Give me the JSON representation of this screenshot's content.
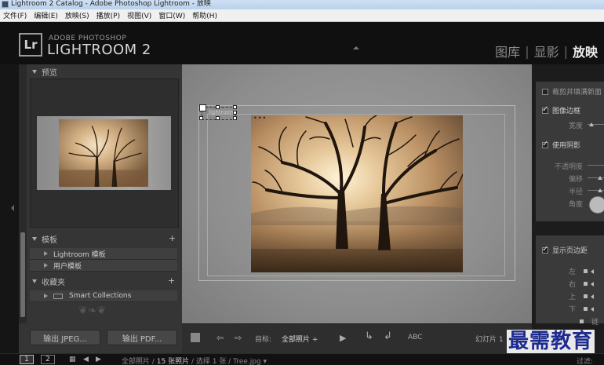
{
  "window": {
    "title": "Lightroom 2 Catalog - Adobe Photoshop Lightroom - 放映"
  },
  "menu": [
    "文件(F)",
    "编辑(E)",
    "放映(S)",
    "播放(P)",
    "视图(V)",
    "窗口(W)",
    "帮助(H)"
  ],
  "brand": {
    "logo": "Lr",
    "line1": "ADOBE PHOTOSHOP",
    "line2": "LIGHTROOM 2"
  },
  "modules": [
    {
      "label": "图库",
      "active": false
    },
    {
      "label": "显影",
      "active": false
    },
    {
      "label": "放映",
      "active": true
    }
  ],
  "left": {
    "preview_title": "预览",
    "templates_title": "模板",
    "templates": [
      "Lightroom 模板",
      "用户模板"
    ],
    "collections_title": "收藏夹",
    "collections": [
      "Smart Collections"
    ],
    "export_jpeg": "输出 JPEG...",
    "export_pdf": "输出 PDF..."
  },
  "slide": {
    "identity_text": "lightroom"
  },
  "toolbar": {
    "target_label": "目标:",
    "target_value": "全部照片 ÷",
    "abc": "ABC",
    "slide_counter": "幻灯片 1"
  },
  "right": {
    "crop_fill": "裁剪并填满新面",
    "image_border": "图像边框",
    "width_label": "宽度",
    "use_shadow": "使用阴影",
    "opacity_label": "不透明度",
    "offset_label": "偏移",
    "radius_label": "半径",
    "angle_label": "角度",
    "show_margins": "显示页边距",
    "margin_left": "左",
    "margin_right": "右",
    "margin_top": "上",
    "margin_bottom": "下",
    "margin_link": "链"
  },
  "status": {
    "page1": "1",
    "page2": "2",
    "info_prefix": "全部照片 /",
    "info_count": "15 张照片",
    "info_suffix": "/ 选择 1 张 / Tree.jpg ▾",
    "filter": "过滤:"
  },
  "watermark": "最需教育"
}
